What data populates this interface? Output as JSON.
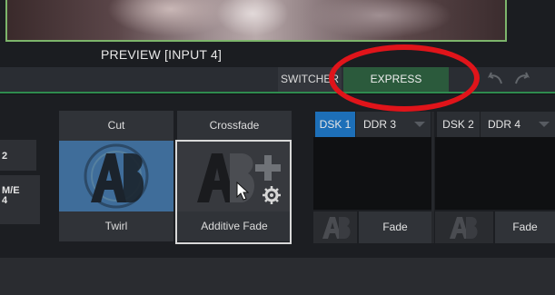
{
  "preview": {
    "label": "PREVIEW [INPUT 4]"
  },
  "tabs": {
    "switcher": "SWITCHER",
    "express": "EXPRESS"
  },
  "me": {
    "tile1": "2",
    "tile2_line1": "M/E",
    "tile2_line2": "4"
  },
  "transitions": {
    "cut": "Cut",
    "crossfade": "Crossfade",
    "twirl": "Twirl",
    "additive_fade": "Additive Fade"
  },
  "dsk": {
    "dsk1": "DSK 1",
    "dsk1_source": "DDR 3",
    "dsk2": "DSK 2",
    "dsk2_source": "DDR 4",
    "fade1": "Fade",
    "fade2": "Fade"
  },
  "colors": {
    "preview_border": "#7db56b",
    "express_tab": "#2b5a3c",
    "tab_underline": "#2f8b4f",
    "dsk_active": "#1d6fb8",
    "cut_thumb": "#3f6d9a",
    "annotation": "#e0141a"
  },
  "icons": {
    "undo": "undo-arrow-icon",
    "redo": "redo-arrow-icon",
    "transition_ab": "ab-transition-icon",
    "gear": "gear-icon",
    "cursor": "mouse-cursor-icon"
  }
}
